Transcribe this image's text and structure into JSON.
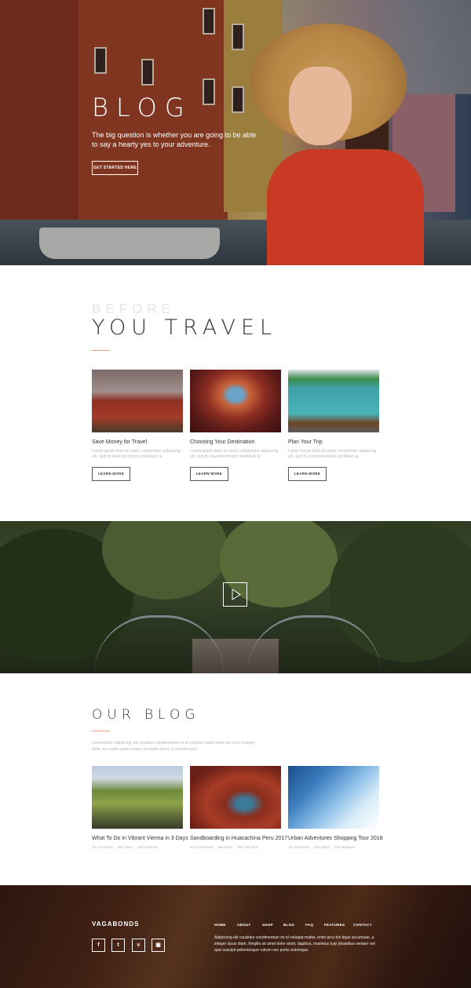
{
  "hero": {
    "title": "BLOG",
    "subtitle": "The big question is whether you are going to be able to say a hearty yes to your adventure.",
    "cta_label": "GET STARTED HERE"
  },
  "travel": {
    "pre_title": "BEFORE",
    "title": "YOU TRAVEL",
    "cards": [
      {
        "title": "Save Money for Travel",
        "text": "Lorem ipsum dolor sit amet, consectetur adipiscing elit, sed do eiusmod tempor incididunt ut",
        "button": "LEARN MORE",
        "image_icon": "red-cabins-mountain-image"
      },
      {
        "title": "Choosing Your Destination",
        "text": "Lorem ipsum dolor sit amet, consectetur adipiscing elit, sed do eiusmod tempor incididunt ut",
        "button": "LEARN MORE",
        "image_icon": "canyon-rock-image"
      },
      {
        "title": "Plan Your Trip",
        "text": "Lorem ipsum dolor sit amet, consectetur adipiscing elit, sed do eiusmod tempor incididunt ut",
        "button": "LEARN MORE",
        "image_icon": "blue-house-image"
      }
    ]
  },
  "video": {
    "play_icon": "play-icon"
  },
  "blog": {
    "title": "OUR BLOG",
    "description": "Consectetur adipiscing elit curabitur condimentum mi id volutpat mattis enim nec eros tristique dolor, eu mattis quam metus non justo donec id mi justo sed",
    "posts": [
      {
        "title": "What To Do in Vibrant Vienna in 3 Days",
        "comments": "25 comments",
        "views": "8M views",
        "reactions": "25k reactions",
        "image_icon": "green-valley-image"
      },
      {
        "title": "Sandboarding in Huacachina Peru 2017",
        "comments": "525 comments",
        "views": "5M views",
        "reactions": "35k reactions",
        "image_icon": "red-canyon-river-image"
      },
      {
        "title": "Urban Adventures Shopping Tour 2018",
        "comments": "15 comments",
        "views": "33k views",
        "reactions": "14k reactions",
        "image_icon": "ice-cave-image"
      }
    ]
  },
  "footer": {
    "brand": "VAGABONDS",
    "social": [
      {
        "label": "f",
        "icon": "facebook-icon"
      },
      {
        "label": "t",
        "icon": "twitter-icon"
      },
      {
        "label": "v",
        "icon": "vimeo-icon"
      },
      {
        "label": "▣",
        "icon": "instagram-icon"
      }
    ],
    "nav": [
      "HOME",
      "ABOUT",
      "SHOP",
      "BLOG",
      "FAQ",
      "FEATURES",
      "CONTACT"
    ],
    "text": "Adipiscing elit curabitur condimentum mi id volutpat mattis, enim arcu tris tique accumsan, a integer lacus diam, fringilla sit amet dolor amet, dapibus, maximus turp phasellus semper est quis suscipit pellentesque rutrum nec porta celerisque."
  },
  "colors": {
    "accent": "#e8a07a",
    "text_dark": "#333333",
    "text_muted": "#b5b5b5"
  }
}
